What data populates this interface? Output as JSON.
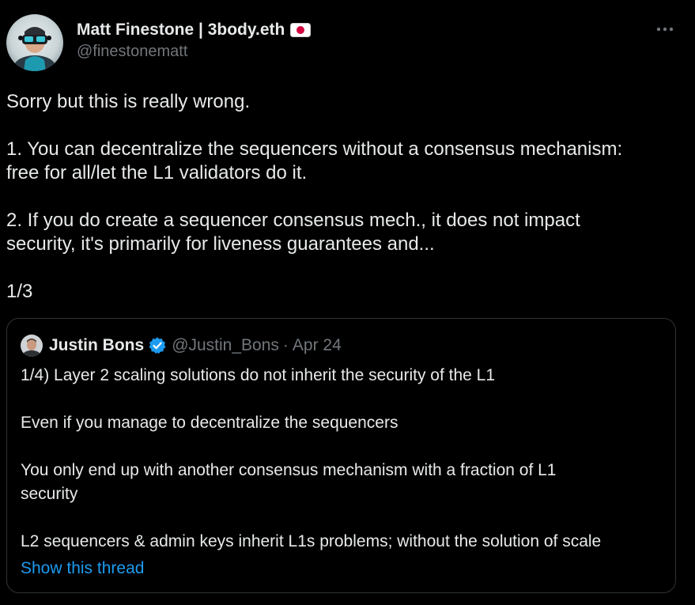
{
  "tweet": {
    "author": {
      "display_name": "Matt Finestone | 3body.eth",
      "handle": "@finestonematt",
      "flag_icon": "japan-flag-icon"
    },
    "more_icon": "more-horizontal-icon",
    "body": {
      "line1": "Sorry but this is really wrong.",
      "line2": "1. You can decentralize the sequencers without a consensus mechanism:",
      "line3": "free for all/let the L1 validators do it.",
      "line4": "2. If you do create a sequencer consensus mech., it does not impact",
      "line5": "security, it's primarily for liveness guarantees and...",
      "line6": "1/3"
    },
    "quote": {
      "display_name": "Justin Bons",
      "verified_icon": "verified-badge-icon",
      "handle": "@Justin_Bons",
      "separator": "·",
      "date": "Apr 24",
      "text": {
        "line1": "1/4) Layer 2 scaling solutions do not inherit the security of the L1",
        "line2": "Even if you manage to decentralize the sequencers",
        "line3": "You only end up with another consensus mechanism with a fraction of L1",
        "line4": "security",
        "line5": "L2 sequencers & admin keys inherit L1s problems; without the solution of scale"
      },
      "show_thread": "Show this thread"
    }
  },
  "colors": {
    "background": "#000000",
    "primary_text": "#e7e9ea",
    "secondary_text": "#71767b",
    "link": "#1d9bf0",
    "border": "#2f3336",
    "verified": "#1d9bf0"
  }
}
